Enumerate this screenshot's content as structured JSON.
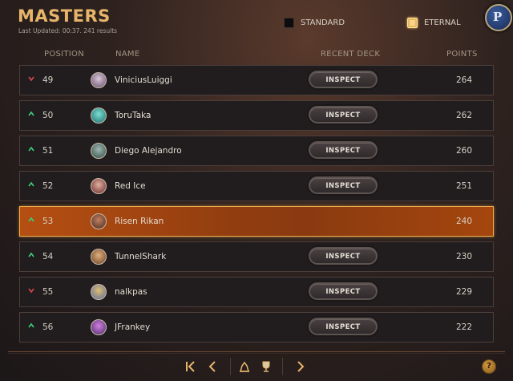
{
  "header": {
    "title": "MASTERS",
    "subtitle": "Last Updated: 00:37. 241 results",
    "filters": [
      {
        "label": "STANDARD",
        "checked": false
      },
      {
        "label": "ETERNAL",
        "checked": true
      }
    ],
    "profile_icon": "profile-badge-icon"
  },
  "columns": {
    "position": "POSITION",
    "name": "NAME",
    "recent_deck": "RECENT DECK",
    "points": "POINTS"
  },
  "rows": [
    {
      "trend": "down",
      "position": "49",
      "name": "ViniciusLuiggi",
      "action": "INSPECT",
      "points": "264"
    },
    {
      "trend": "up",
      "position": "50",
      "name": "ToruTaka",
      "action": "INSPECT",
      "points": "262"
    },
    {
      "trend": "up",
      "position": "51",
      "name": "Diego Alejandro",
      "action": "INSPECT",
      "points": "260"
    },
    {
      "trend": "up",
      "position": "52",
      "name": "Red Ice",
      "action": "INSPECT",
      "points": "251"
    },
    {
      "trend": "up",
      "position": "53",
      "name": "Risen Rikan",
      "action": "",
      "points": "240",
      "highlighted": true
    },
    {
      "trend": "up",
      "position": "54",
      "name": "TunnelShark",
      "action": "INSPECT",
      "points": "230"
    },
    {
      "trend": "down",
      "position": "55",
      "name": "nalkpas",
      "action": "INSPECT",
      "points": "229"
    },
    {
      "trend": "up",
      "position": "56",
      "name": "JFrankey",
      "action": "INSPECT",
      "points": "222"
    }
  ],
  "colors": {
    "accent": "#e7b56a",
    "up": "#3ecf7a",
    "down": "#d64a4a",
    "highlight": "#b54f12"
  },
  "footer": {
    "icons": [
      "first-page-icon",
      "previous-page-icon",
      "my-rank-icon",
      "top-rank-icon",
      "next-page-icon"
    ],
    "help": "?"
  }
}
